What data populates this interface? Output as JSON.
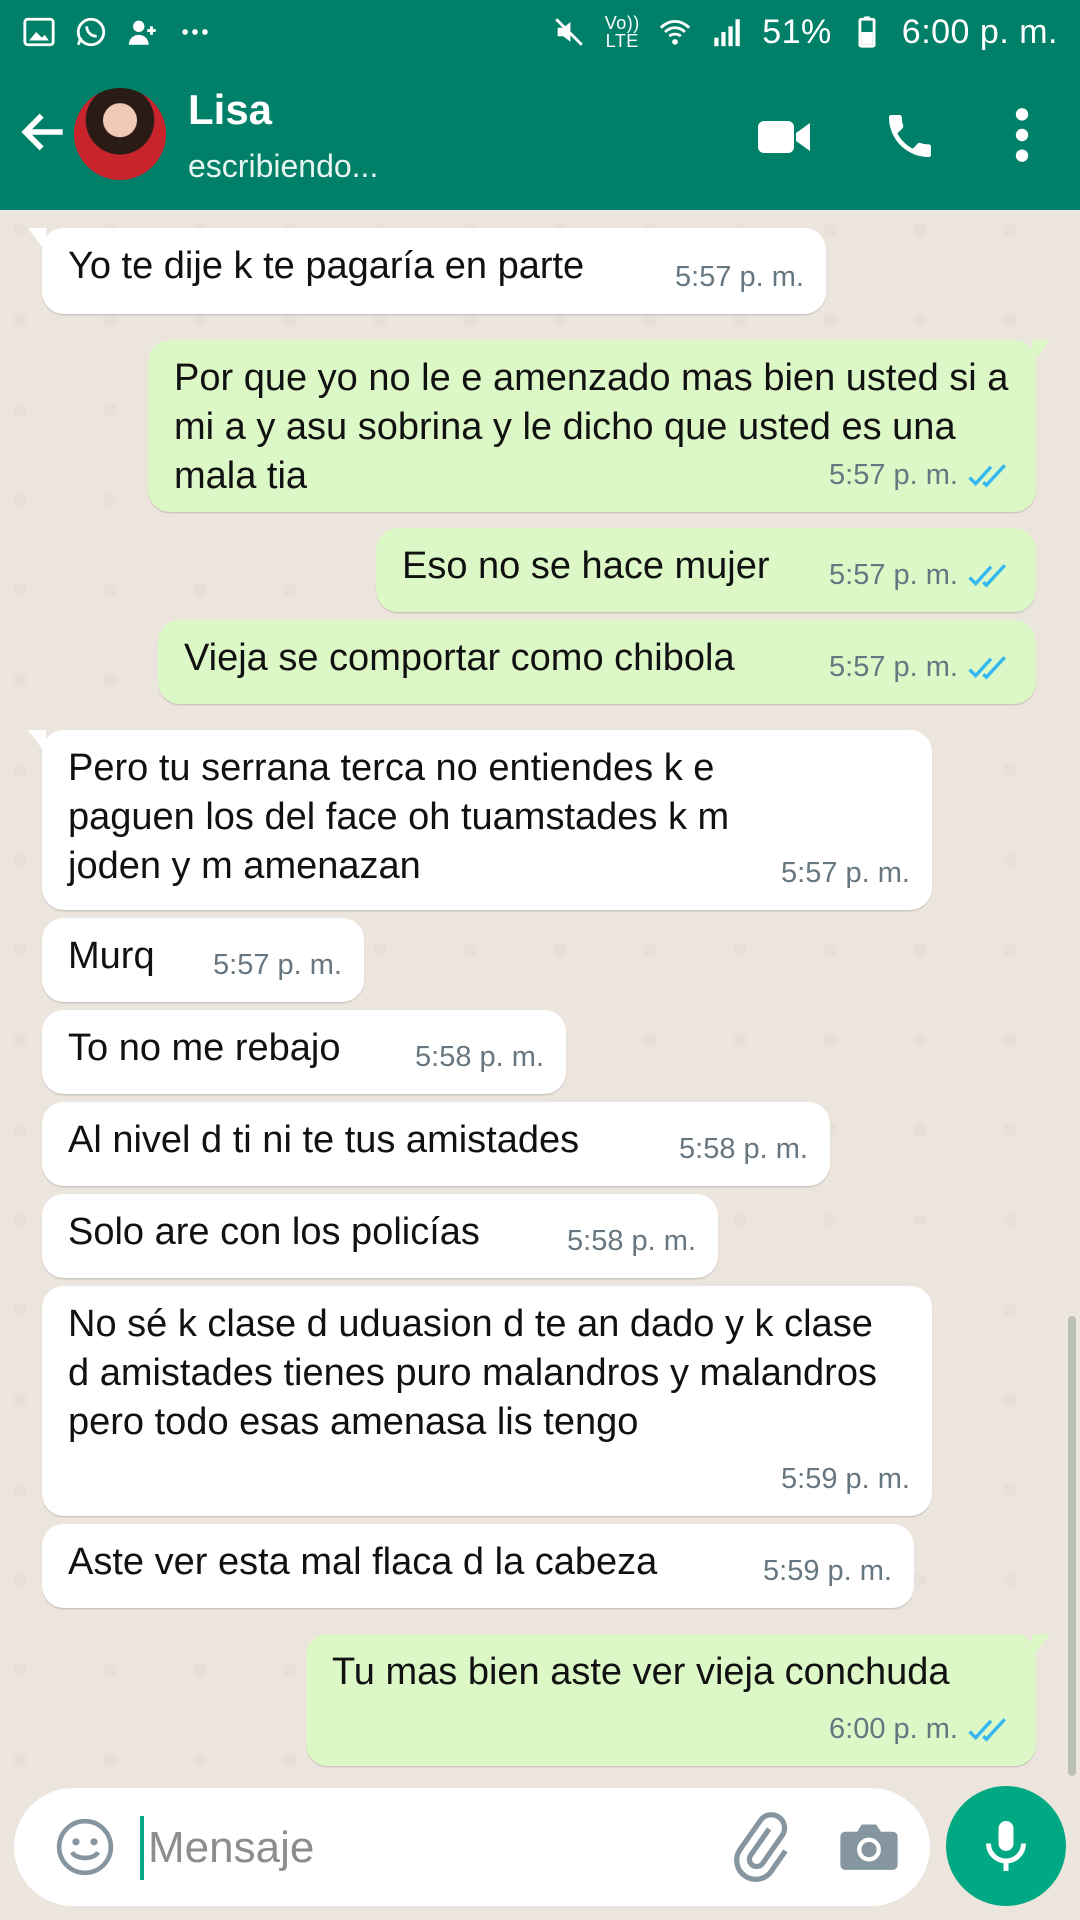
{
  "status_bar": {
    "battery": "51%",
    "time": "6:00 p. m.",
    "network": "Vo)) LTE",
    "icons_left": [
      "gallery-icon",
      "whatsapp-icon",
      "add-contact-icon",
      "more-notifications-icon"
    ],
    "icons_right": [
      "mute-icon",
      "volte-icon",
      "wifi-icon",
      "signal-icon",
      "battery-icon"
    ]
  },
  "header": {
    "contact_name": "Lisa",
    "status": "escribiendo..."
  },
  "colors": {
    "header": "#008069",
    "chat_background": "#ECE5DD",
    "incoming_bubble": "#FFFFFF",
    "outgoing_bubble": "#DCF8C6",
    "read_ticks": "#34B7F1",
    "mic_button": "#00A884"
  },
  "messages": [
    {
      "direction": "in",
      "text": "Yo te dije k te pagaría en parte",
      "time": "5:57 p. m."
    },
    {
      "direction": "out",
      "text": "Por que yo no le e amenzado mas bien usted si a mi a y asu sobrina y le dicho que usted es una mala tia",
      "time": "5:57 p. m.",
      "read": true
    },
    {
      "direction": "out",
      "text": "Eso no se hace mujer",
      "time": "5:57 p. m.",
      "read": true
    },
    {
      "direction": "out",
      "text": "Vieja se comportar como chibola",
      "time": "5:57 p. m.",
      "read": true
    },
    {
      "direction": "in",
      "text": "Pero tu serrana terca no entiendes k e paguen los del face oh tuamstades k m joden y m amenazan",
      "time": "5:57 p. m."
    },
    {
      "direction": "in",
      "text": "Murq",
      "time": "5:57 p. m."
    },
    {
      "direction": "in",
      "text": "To no me rebajo",
      "time": "5:58 p. m."
    },
    {
      "direction": "in",
      "text": "Al nivel d ti ni te tus amistades",
      "time": "5:58 p. m."
    },
    {
      "direction": "in",
      "text": "Solo are con los policías",
      "time": "5:58 p. m."
    },
    {
      "direction": "in",
      "text": "No sé k clase d uduasion d te an dado y k clase d amistades tienes puro malandros y malandros pero todo esas amenasa lis tengo",
      "time": "5:59 p. m."
    },
    {
      "direction": "in",
      "text": "Aste ver esta mal flaca d la cabeza",
      "time": "5:59 p. m."
    },
    {
      "direction": "out",
      "text": "Tu mas bien aste ver vieja conchuda",
      "time": "6:00 p. m.",
      "read": true
    }
  ],
  "composer": {
    "placeholder": "Mensaje"
  }
}
